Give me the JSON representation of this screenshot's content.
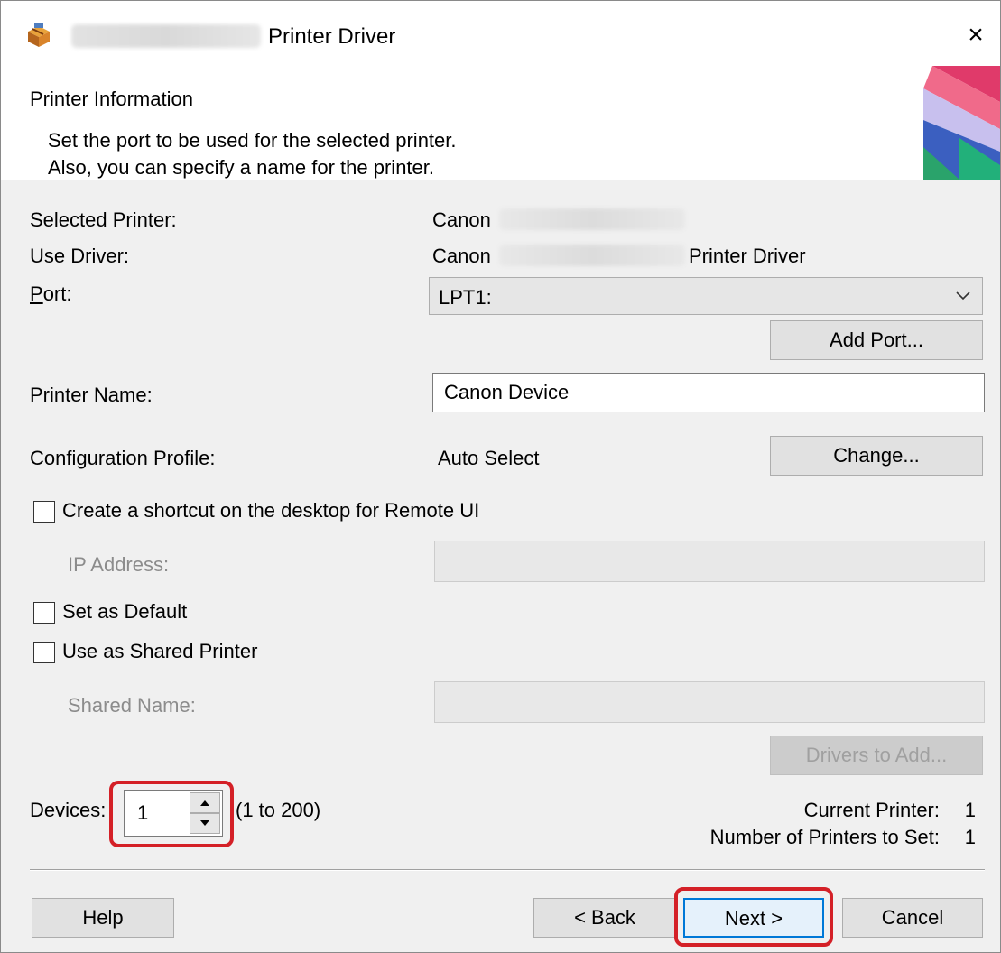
{
  "window": {
    "title": "Printer Driver",
    "close_glyph": "×"
  },
  "header": {
    "title": "Printer Information",
    "line1": "Set the port to be used for the selected printer.",
    "line2": "Also, you can specify a name for the printer."
  },
  "fields": {
    "selected_printer_label": "Selected Printer:",
    "selected_printer_value": "Canon",
    "use_driver_label": "Use Driver:",
    "use_driver_value": "Canon",
    "use_driver_suffix": "Printer Driver",
    "port_label": "Port:",
    "port_value": "LPT1:",
    "add_port_label": "Add Port...",
    "printer_name_label": "Printer Name:",
    "printer_name_value": "Canon Device",
    "config_profile_label": "Configuration Profile:",
    "config_profile_value": "Auto Select",
    "change_label": "Change...",
    "remote_ui_label": "Create a shortcut on the desktop for Remote UI",
    "ip_address_label": "IP Address:",
    "set_default_label": "Set as Default",
    "shared_printer_label": "Use as Shared Printer",
    "shared_name_label": "Shared Name:",
    "drivers_to_add_label": "Drivers to Add..."
  },
  "devices": {
    "label": "Devices:",
    "value": "1",
    "range": "(1 to 200)",
    "current_printer_label": "Current Printer:",
    "current_printer_value": "1",
    "number_to_set_label": "Number of Printers to Set:",
    "number_to_set_value": "1"
  },
  "buttons": {
    "help": "Help",
    "back": "< Back",
    "next": "Next >",
    "cancel": "Cancel"
  },
  "colors": {
    "highlight": "#d42027"
  },
  "icons": [
    "printer-box-icon",
    "close-icon",
    "chevron-down-icon",
    "spin-up-icon",
    "spin-down-icon"
  ]
}
